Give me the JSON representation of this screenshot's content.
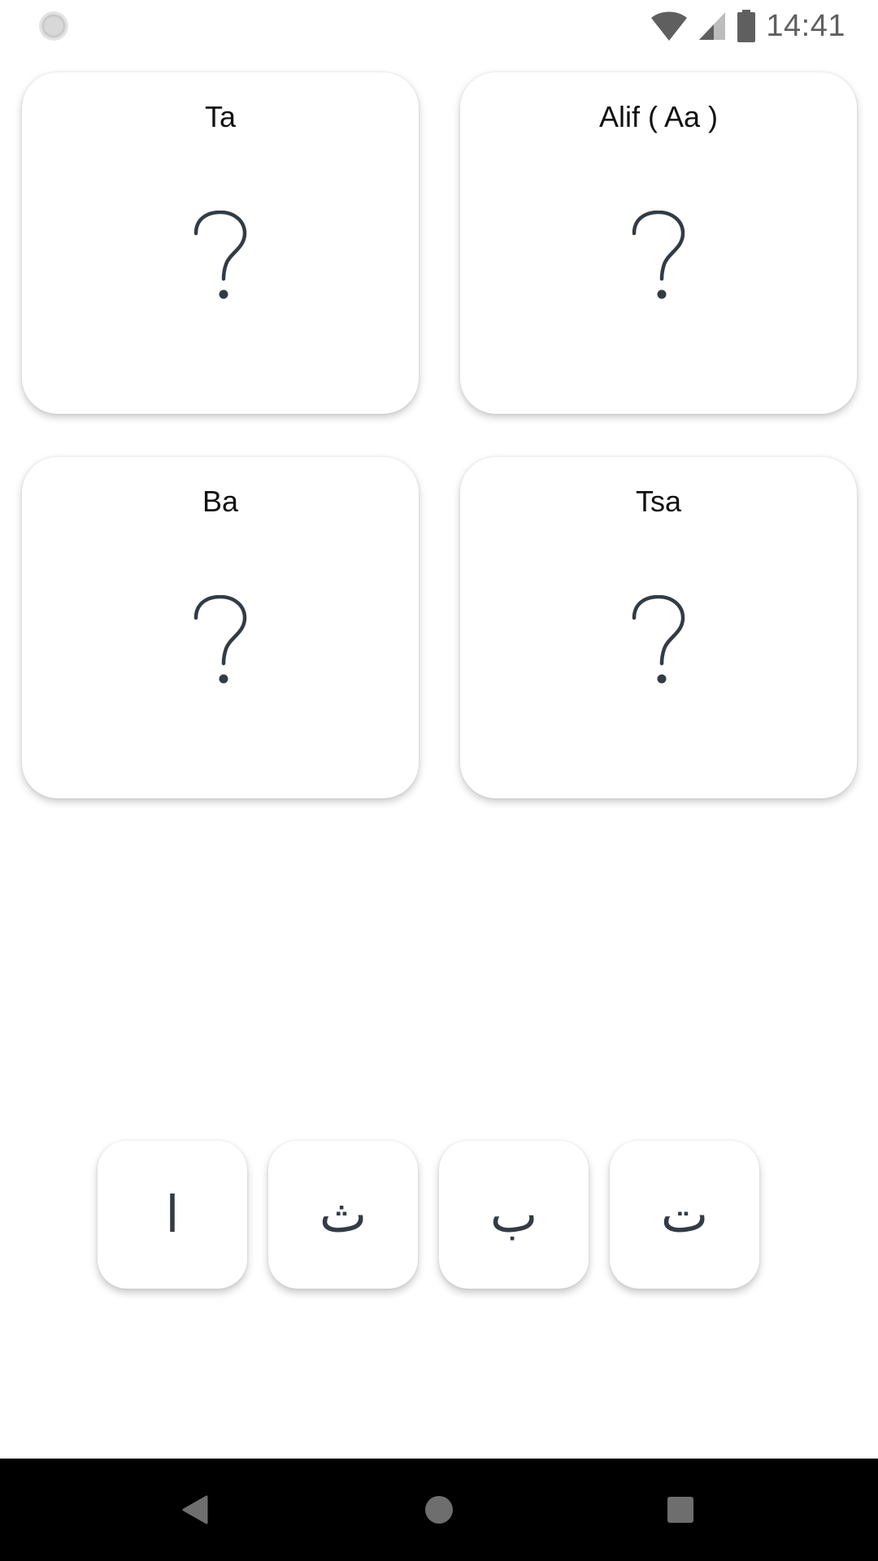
{
  "status_bar": {
    "time": "14:41",
    "icons": [
      "loading-icon",
      "wifi-icon",
      "signal-icon",
      "battery-icon"
    ]
  },
  "cards": [
    {
      "label": "Ta",
      "placeholder": "?"
    },
    {
      "label": "Alif ( Aa )",
      "placeholder": "?"
    },
    {
      "label": "Ba",
      "placeholder": "?"
    },
    {
      "label": "Tsa",
      "placeholder": "?"
    }
  ],
  "letters": [
    "ا",
    "ث",
    "ب",
    "ت"
  ],
  "nav_bar": {
    "buttons": [
      "back-icon",
      "home-icon",
      "recents-icon"
    ]
  },
  "colors": {
    "background": "#ffffff",
    "question_mark": "#333b45",
    "status_icons": "#5f5f5f",
    "nav_bar": "#000000"
  }
}
